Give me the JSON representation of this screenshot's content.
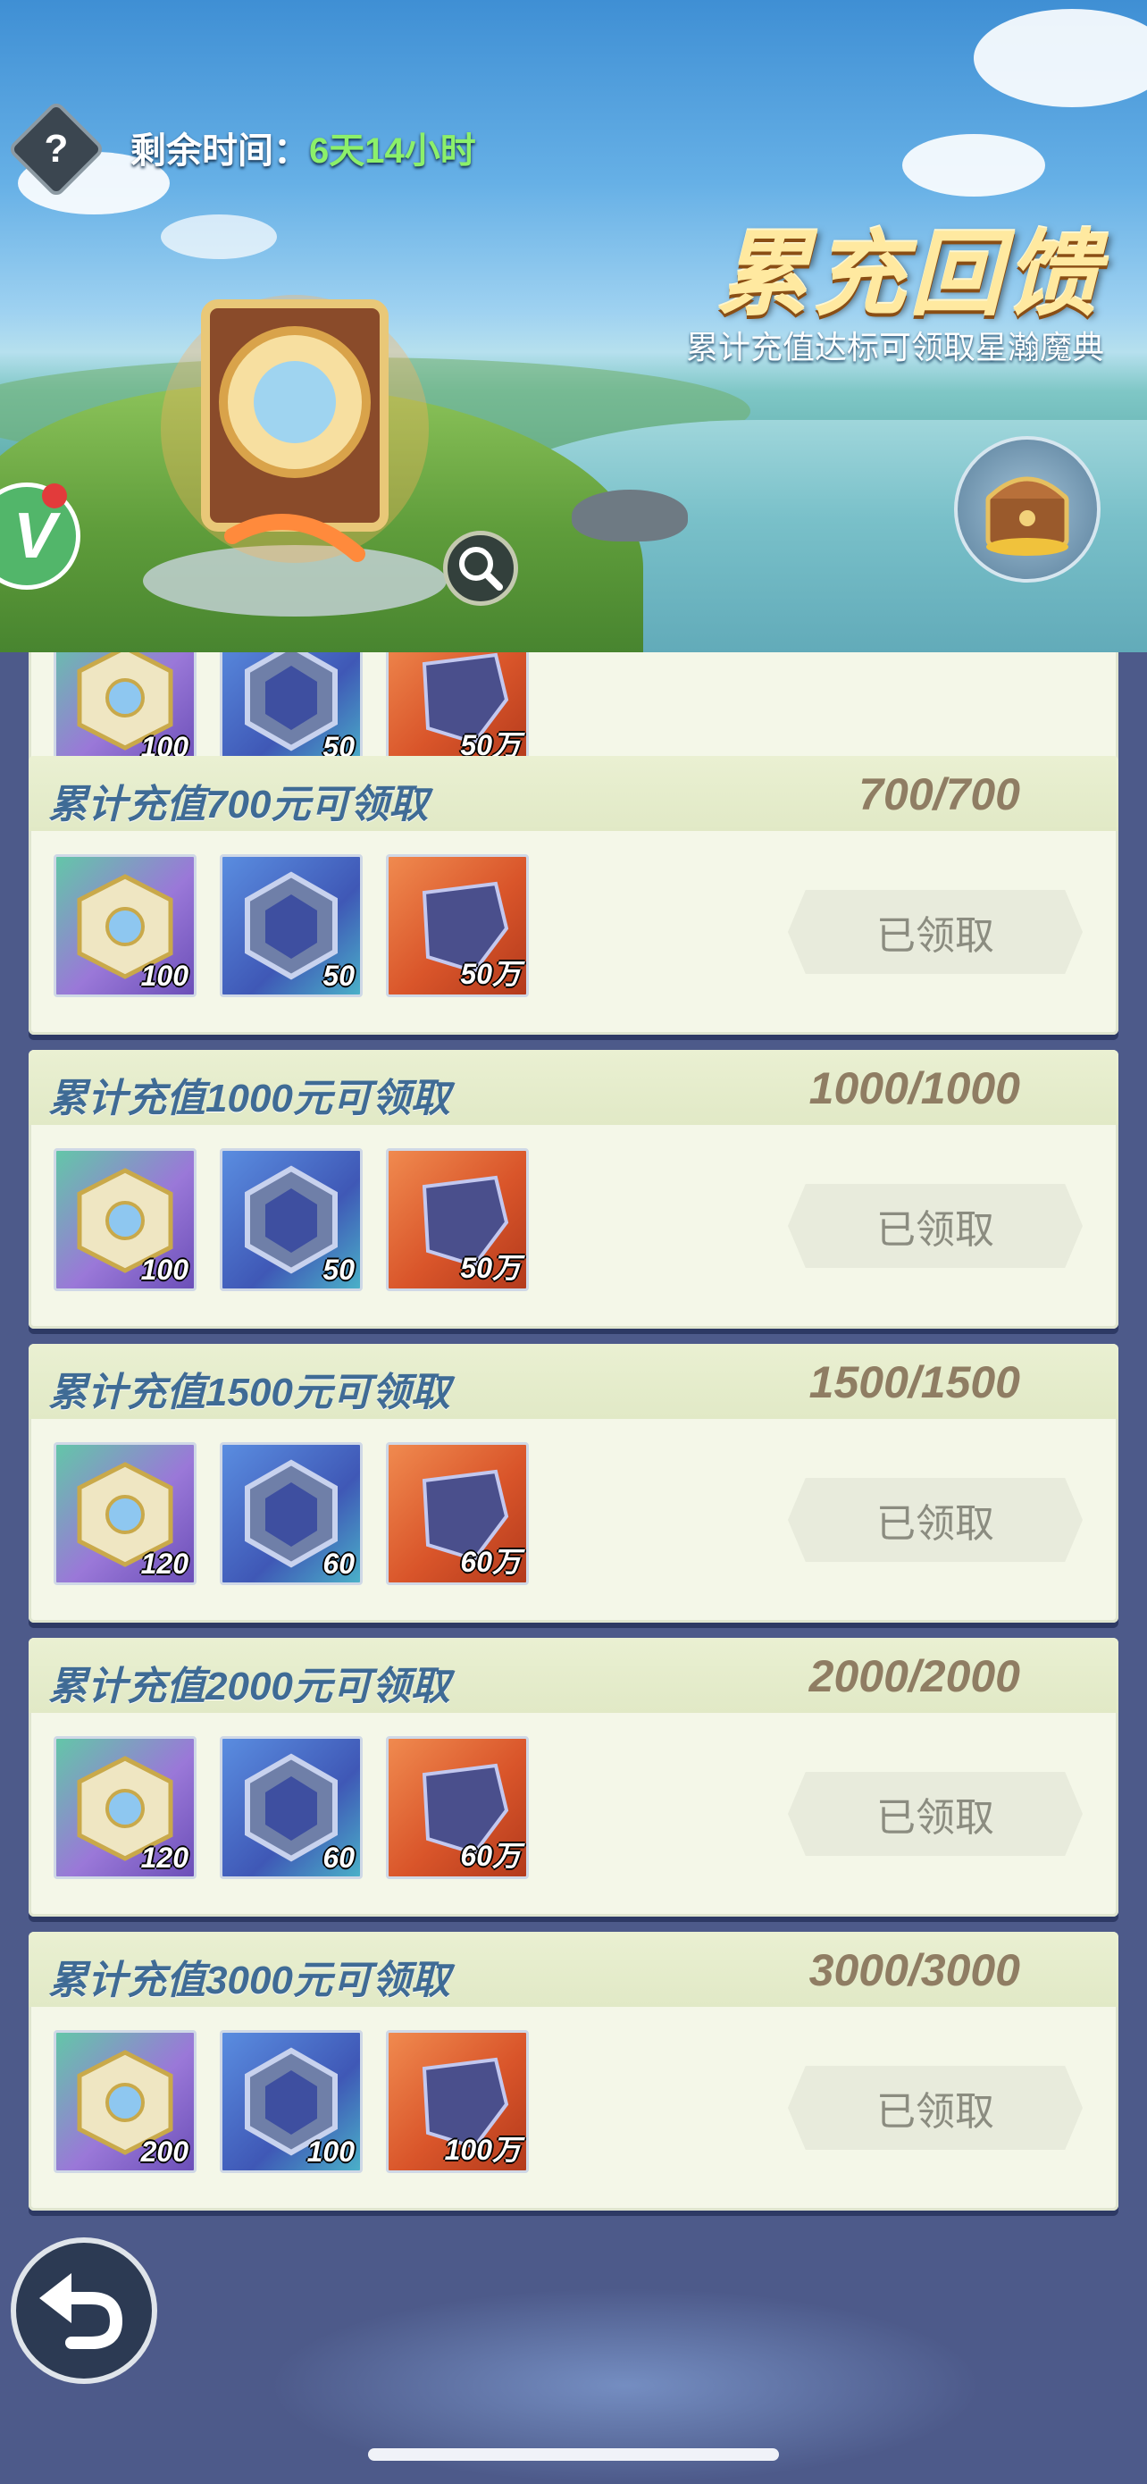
{
  "banner": {
    "timer_label": "剩余时间：",
    "timer_value": "6天14小时",
    "title": "累充回馈",
    "subtitle": "累计充值达标可领取星瀚魔典"
  },
  "help_icon": "?",
  "cards": [
    {
      "title": "",
      "progress": "",
      "items": [
        "100",
        "50",
        "50万"
      ],
      "button": ""
    },
    {
      "title": "累计充值700元可领取",
      "progress": "700/700",
      "items": [
        "100",
        "50",
        "50万"
      ],
      "button": "已领取"
    },
    {
      "title": "累计充值1000元可领取",
      "progress": "1000/1000",
      "items": [
        "100",
        "50",
        "50万"
      ],
      "button": "已领取"
    },
    {
      "title": "累计充值1500元可领取",
      "progress": "1500/1500",
      "items": [
        "120",
        "60",
        "60万"
      ],
      "button": "已领取"
    },
    {
      "title": "累计充值2000元可领取",
      "progress": "2000/2000",
      "items": [
        "120",
        "60",
        "60万"
      ],
      "button": "已领取"
    },
    {
      "title": "累计充值3000元可领取",
      "progress": "3000/3000",
      "items": [
        "200",
        "100",
        "100万"
      ],
      "button": "已领取"
    }
  ],
  "colors": {
    "title_blue": "#3f6b95",
    "progress_tan": "#8f7d63",
    "timer_green": "#8cf06a",
    "bg_navy": "#4d5a8a"
  }
}
